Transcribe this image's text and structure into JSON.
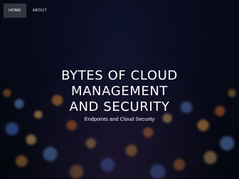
{
  "nav": {
    "items": [
      {
        "label": "HOME",
        "active": true
      },
      {
        "label": "ABOUT",
        "active": false
      }
    ]
  },
  "hero": {
    "title_lines": [
      "BYTES OF CLOUD",
      "MANAGEMENT",
      "AND SECURITY"
    ],
    "subtitle": "Endpoints and Cloud Security"
  },
  "colors": {
    "background": "#0b0e1c",
    "nav_active_bg": "rgba(255,255,255,0.18)",
    "text": "#ffffff"
  }
}
